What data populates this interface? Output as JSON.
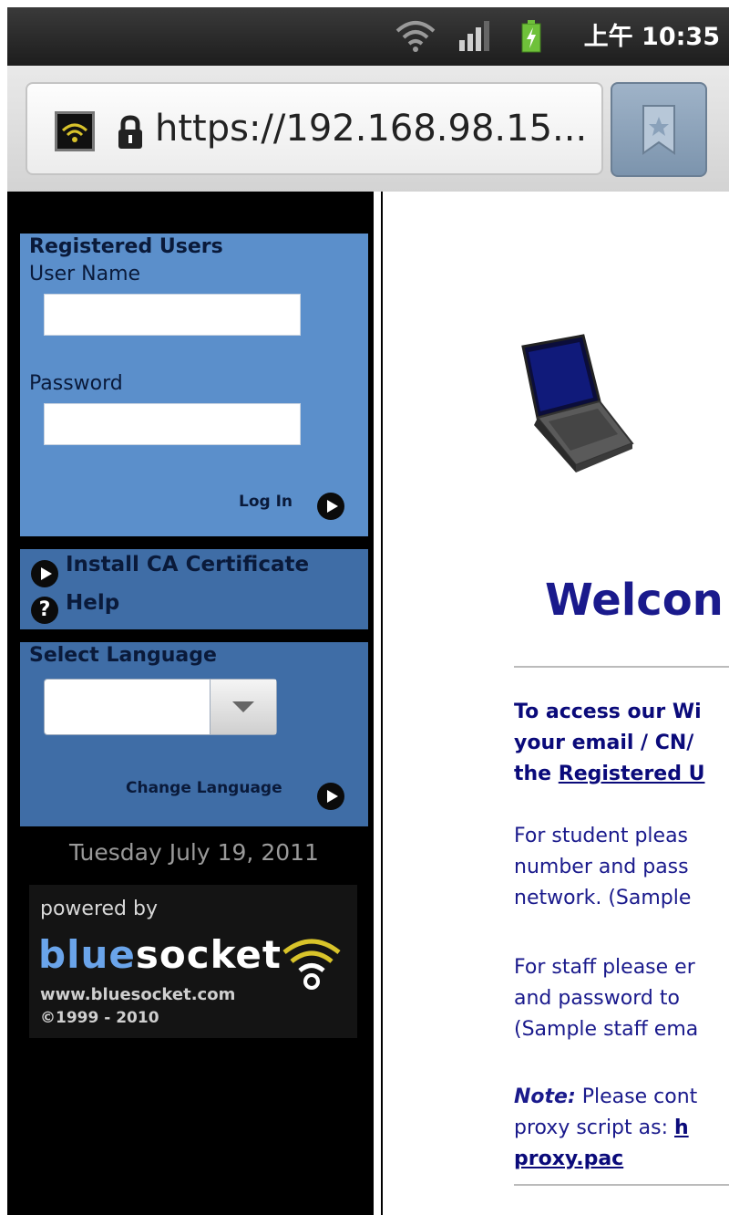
{
  "status_bar": {
    "time": "上午 10:35",
    "icons": [
      "wifi-icon",
      "signal-icon",
      "battery-charging-icon"
    ]
  },
  "browser": {
    "url": "https://192.168.98.15...",
    "icons": [
      "site-favicon-icon",
      "lock-icon",
      "bookmark-icon"
    ]
  },
  "sidebar": {
    "login": {
      "heading": "Registered Users",
      "username_label": "User Name",
      "username_value": "",
      "password_label": "Password",
      "password_value": "",
      "login_label": "Log In"
    },
    "links": {
      "install_cert": "Install CA Certificate",
      "help": "Help",
      "help_icon_glyph": "?"
    },
    "language": {
      "heading": "Select Language",
      "selected": "",
      "change_label": "Change Language"
    },
    "date": "Tuesday July 19, 2011",
    "powered": {
      "powered_by": "powered by",
      "brand_blue": "blue",
      "brand_rest": "socket",
      "url": "www.bluesocket.com",
      "copyright": "©1999 - 2010"
    }
  },
  "main": {
    "welcome": "Welcon",
    "para1": [
      "To access our Wi",
      "your email / CN/",
      "the "
    ],
    "para1_link": "Registered U",
    "para2": [
      "For student pleas",
      "number and pass",
      "network.  (Sample"
    ],
    "para3": [
      "For staff please er",
      "and password to ",
      "(Sample staff ema"
    ],
    "note_label": "Note:",
    "para4_first": " Please cont",
    "para4_second": "proxy script as: ",
    "para4_link_a": "h",
    "para4_link_b": "proxy.pac"
  },
  "colors": {
    "login_panel": "#5b8fcb",
    "secondary_panel": "#3f6da6",
    "welcome_text": "#1a1a8c",
    "sidebar_bg": "#000000"
  }
}
